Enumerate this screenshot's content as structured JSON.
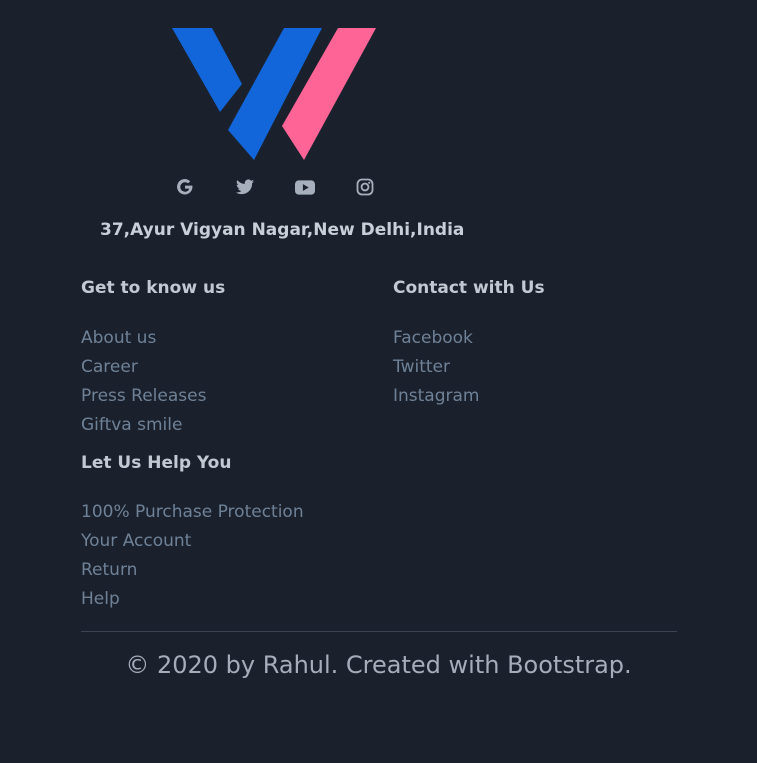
{
  "brand": {
    "logo": "V logo",
    "colors": {
      "blue": "#1266d9",
      "pink": "#ff6496",
      "background": "#1a212c"
    }
  },
  "social": [
    {
      "icon": "google-icon",
      "label": "Google"
    },
    {
      "icon": "twitter-icon",
      "label": "Twitter"
    },
    {
      "icon": "youtube-icon",
      "label": "YouTube"
    },
    {
      "icon": "instagram-icon",
      "label": "Instagram"
    }
  ],
  "address": "37,Ayur Vigyan Nagar,New Delhi,India",
  "sections": {
    "get_to_know": {
      "heading": "Get to know us",
      "links": [
        "About us",
        "Career",
        "Press Releases",
        "Giftva smile"
      ]
    },
    "contact": {
      "heading": "Contact with Us",
      "links": [
        "Facebook",
        "Twitter",
        "Instagram"
      ]
    },
    "help": {
      "heading": "Let Us Help You",
      "links": [
        "100% Purchase Protection",
        "Your Account",
        "Return",
        "Help"
      ]
    }
  },
  "copyright": "© 2020 by Rahul. Created with Bootstrap."
}
